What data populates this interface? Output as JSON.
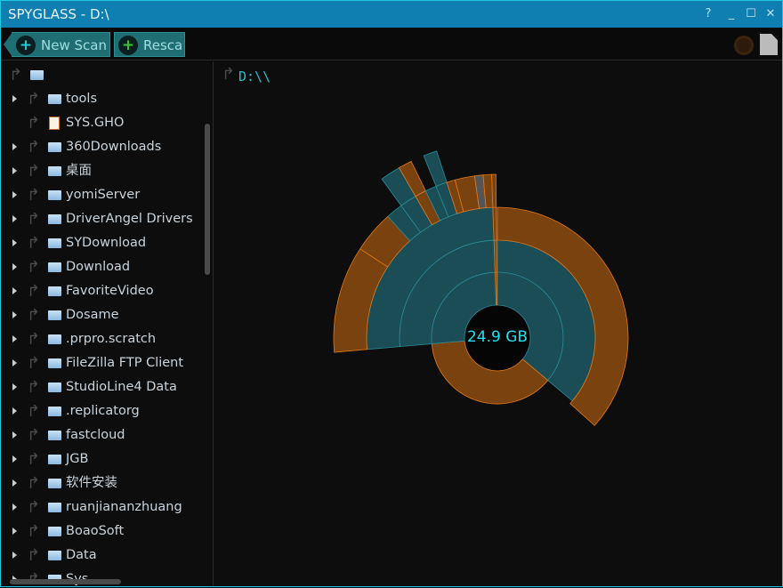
{
  "window": {
    "title": "SPYGLASS - D:\\",
    "help": "?",
    "minimize": "_",
    "maximize": "☐",
    "close": "✕"
  },
  "toolbar": {
    "new_scan": "New Scan",
    "rescan": "Resca"
  },
  "tree": {
    "items": [
      {
        "label": "tools",
        "type": "folder"
      },
      {
        "label": "SYS.GHO",
        "type": "file"
      },
      {
        "label": "360Downloads",
        "type": "folder"
      },
      {
        "label": "桌面",
        "type": "folder"
      },
      {
        "label": "yomiServer",
        "type": "folder"
      },
      {
        "label": "DriverAngel Drivers",
        "type": "folder"
      },
      {
        "label": "SYDownload",
        "type": "folder"
      },
      {
        "label": "Download",
        "type": "folder"
      },
      {
        "label": "FavoriteVideo",
        "type": "folder"
      },
      {
        "label": "Dosame",
        "type": "folder"
      },
      {
        "label": ".prpro.scratch",
        "type": "folder"
      },
      {
        "label": "FileZilla FTP Client",
        "type": "folder"
      },
      {
        "label": "StudioLine4 Data",
        "type": "folder"
      },
      {
        "label": ".replicatorg",
        "type": "folder"
      },
      {
        "label": "fastcloud",
        "type": "folder"
      },
      {
        "label": "JGB",
        "type": "folder"
      },
      {
        "label": "软件安装",
        "type": "folder"
      },
      {
        "label": "ruanjiananzhuang",
        "type": "folder"
      },
      {
        "label": "BoaoSoft",
        "type": "folder"
      },
      {
        "label": "Data",
        "type": "folder"
      },
      {
        "label": "Sys",
        "type": "folder"
      }
    ]
  },
  "main": {
    "path": "D:\\\\",
    "total_size": "24.9 GB"
  },
  "colors": {
    "folder": "#1b4d57",
    "file": "#7a420f",
    "accent": "#1fd8e8",
    "titlebar": "#0f7fb2"
  }
}
